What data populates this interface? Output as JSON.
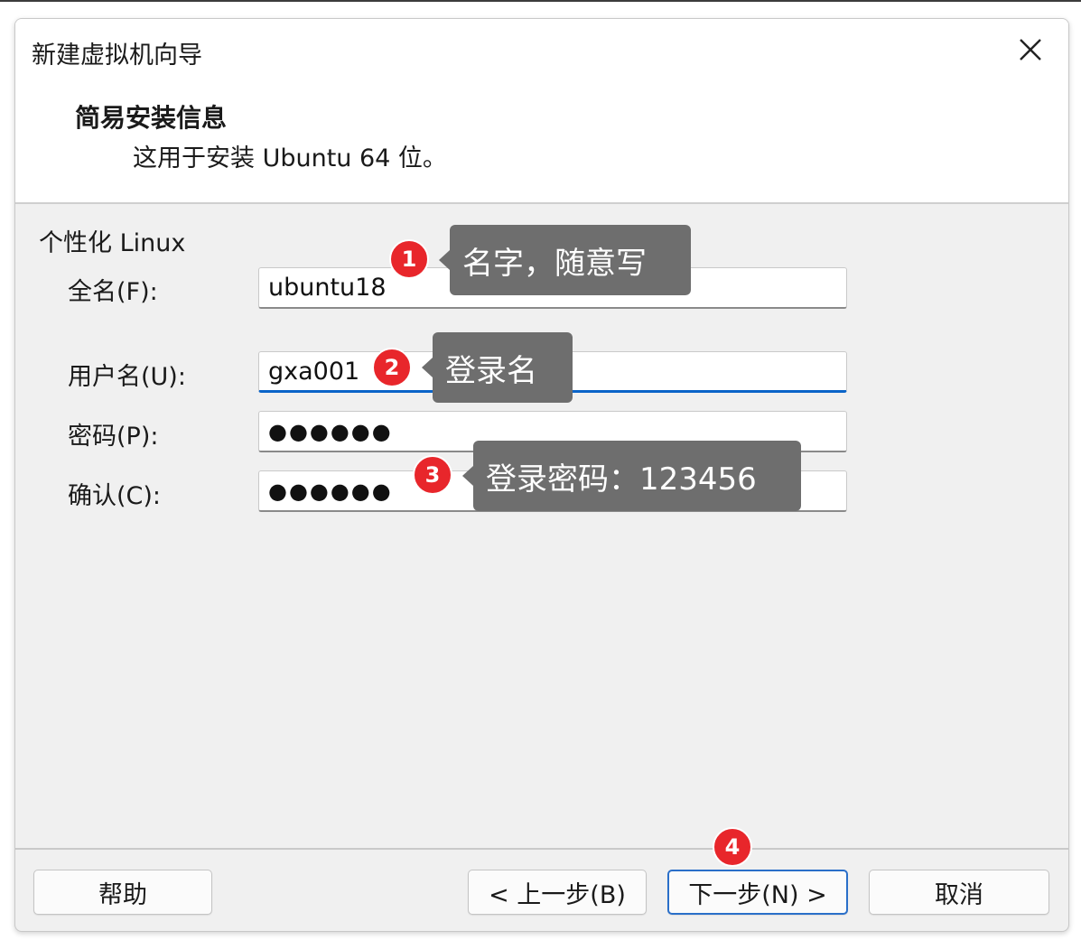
{
  "window": {
    "title": "新建虚拟机向导",
    "close_icon": "close-icon"
  },
  "header": {
    "heading": "简易安装信息",
    "subheading": "这用于安装 Ubuntu 64 位。"
  },
  "form": {
    "section_label": "个性化 Linux",
    "fullname_label": "全名(F):",
    "fullname_value": "ubuntu18",
    "username_label": "用户名(U):",
    "username_value": "gxa001",
    "password_label": "密码(P):",
    "password_value": "●●●●●●",
    "confirm_label": "确认(C):",
    "confirm_value": "●●●●●●"
  },
  "annotations": [
    {
      "number": "1",
      "text": "名字，随意写"
    },
    {
      "number": "2",
      "text": "登录名"
    },
    {
      "number": "3",
      "text": "登录密码：123456"
    },
    {
      "number": "4"
    }
  ],
  "buttons": {
    "help": "帮助",
    "back": "< 上一步(B)",
    "next": "下一步(N) >",
    "cancel": "取消"
  },
  "colors": {
    "accent": "#0a64c8",
    "badge": "#e8262b",
    "callout": "#6e6e6e"
  }
}
